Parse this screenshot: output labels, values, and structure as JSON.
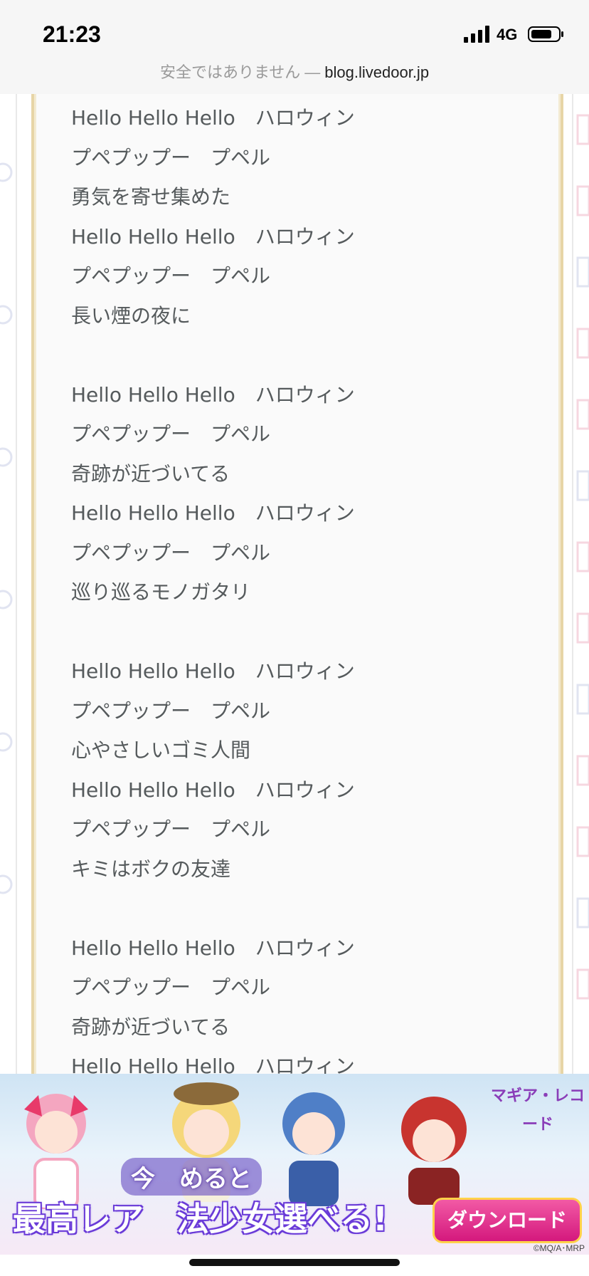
{
  "status_bar": {
    "time": "21:23",
    "network": "4G",
    "icons": [
      "signal-icon",
      "battery-icon"
    ]
  },
  "address_bar": {
    "security_label": "安全ではありません",
    "separator": "—",
    "domain": "blog.livedoor.jp"
  },
  "lyrics": {
    "stanzas": [
      {
        "lines": [
          "Hello Hello Hello　ハロウィン",
          "プペプップー　プペル",
          "勇気を寄せ集めた",
          "Hello Hello Hello　ハロウィン",
          "プペプップー　プペル",
          "長い煙の夜に"
        ]
      },
      {
        "lines": [
          "Hello Hello Hello　ハロウィン",
          "プペプップー　プペル",
          "奇跡が近づいてる",
          "Hello Hello Hello　ハロウィン",
          "プペプップー　プペル",
          "巡り巡るモノガタリ"
        ]
      },
      {
        "lines": [
          "Hello Hello Hello　ハロウィン",
          "プペプップー　プペル",
          "心やさしいゴミ人間",
          "Hello Hello Hello　ハロウィン",
          "プペプップー　プペル",
          "キミはボクの友達"
        ]
      },
      {
        "lines": [
          "Hello Hello Hello　ハロウィン",
          "プペプップー　プペル",
          "奇跡が近づいてる",
          "Hello Hello Hello　ハロウィン"
        ]
      }
    ]
  },
  "ad": {
    "headline_top": "今　めると",
    "headline": "最高レア　法少女選べる!",
    "download_label": "ダウンロード",
    "game_logo": "マギア・レコード",
    "copyright": "©MQ/A･MRP"
  },
  "colors": {
    "status_bg": "#f6f6f6",
    "lyric_text": "#555a5c",
    "frame_gold": "#e7d5a6",
    "download_pink": "#d4187d"
  }
}
